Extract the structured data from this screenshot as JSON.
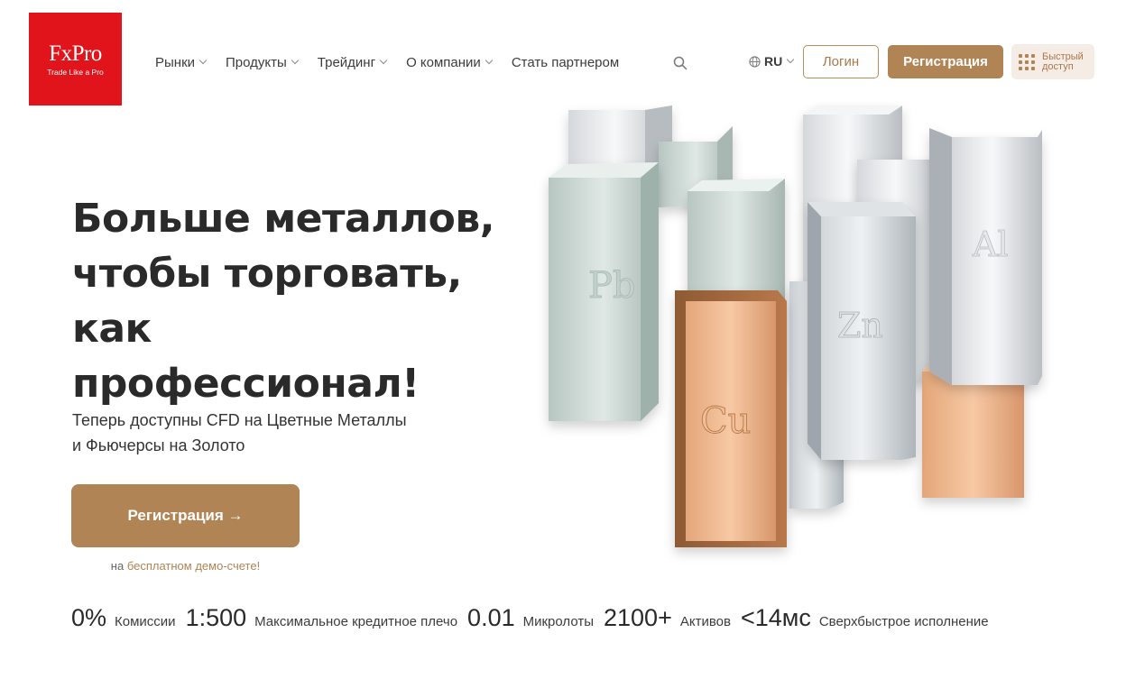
{
  "brand": {
    "name": "FxPro",
    "tagline": "Trade Like a Pro",
    "color": "#e2141b"
  },
  "nav": {
    "items": [
      {
        "label": "Рынки",
        "dropdown": true
      },
      {
        "label": "Продукты",
        "dropdown": true
      },
      {
        "label": "Трейдинг",
        "dropdown": true
      },
      {
        "label": "О компании",
        "dropdown": true
      },
      {
        "label": "Стать партнером",
        "dropdown": false
      }
    ],
    "search_icon": "search-icon"
  },
  "header": {
    "language": "RU",
    "login_label": "Логин",
    "register_label": "Регистрация",
    "quick_access_label": "Быстрый доступ"
  },
  "hero": {
    "title_lines": [
      "Больше металлов,",
      "чтобы торговать,",
      "как",
      "профессионал!"
    ],
    "subtitle": "Теперь доступны CFD на Цветные Металлы и Фьючерсы на Золото",
    "cta_label": "Регистрация →",
    "cta_note_prefix": "на",
    "cta_note_link": "бесплатном демо-счете!"
  },
  "metals": [
    "Pb",
    "Cu",
    "Zn",
    "Al"
  ],
  "stats": [
    {
      "value": "0%",
      "label": "Комиссии"
    },
    {
      "value": "1:500",
      "label": "Максимальное кредитное плечо"
    },
    {
      "value": "0.01",
      "label": "Микролоты"
    },
    {
      "value": "2100+",
      "label": "Активов"
    },
    {
      "value": "<14мс",
      "label": "Сверхбыстрое исполнение"
    }
  ],
  "colors": {
    "accent": "#b08455",
    "accent_light": "#f5ede5",
    "text": "#2a2a2a"
  }
}
